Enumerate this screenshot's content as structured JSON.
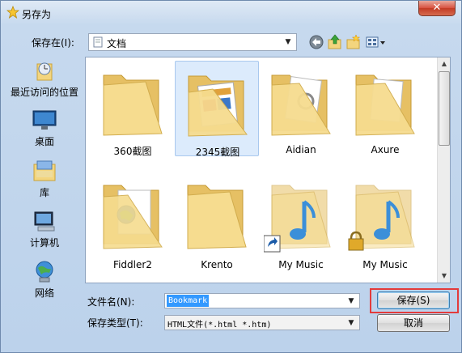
{
  "window": {
    "title": "另存为",
    "close_label": "✕"
  },
  "lookin": {
    "label": "保存在(I):",
    "value": "文档"
  },
  "toolbar": {
    "icons": [
      "back-icon",
      "up-folder-icon",
      "new-folder-icon",
      "view-menu-icon"
    ]
  },
  "places": [
    {
      "label": "最近访问的位置",
      "icon": "recent-places-icon"
    },
    {
      "label": "桌面",
      "icon": "desktop-icon"
    },
    {
      "label": "库",
      "icon": "libraries-icon"
    },
    {
      "label": "计算机",
      "icon": "computer-icon"
    },
    {
      "label": "网络",
      "icon": "network-icon"
    }
  ],
  "files": [
    {
      "name": "360截图",
      "icon": "folder-icon"
    },
    {
      "name": "2345截图",
      "icon": "folder-icon",
      "selected": true
    },
    {
      "name": "Aidian",
      "icon": "folder-icon"
    },
    {
      "name": "Axure",
      "icon": "folder-icon"
    },
    {
      "name": "Fiddler2",
      "icon": "folder-icon"
    },
    {
      "name": "Krento",
      "icon": "folder-icon"
    },
    {
      "name": "My Music",
      "icon": "music-folder-shortcut-icon"
    },
    {
      "name": "My Music",
      "icon": "music-folder-locked-icon"
    }
  ],
  "filename": {
    "label": "文件名(N):",
    "value": "Bookmark"
  },
  "filetype": {
    "label": "保存类型(T):",
    "value": "HTML文件(*.html *.htm)"
  },
  "buttons": {
    "save": "保存(S)",
    "cancel": "取消"
  },
  "colors": {
    "selection": "#3399ff",
    "highlight_box": "#e33b3b",
    "folder": "#f3d57e"
  }
}
